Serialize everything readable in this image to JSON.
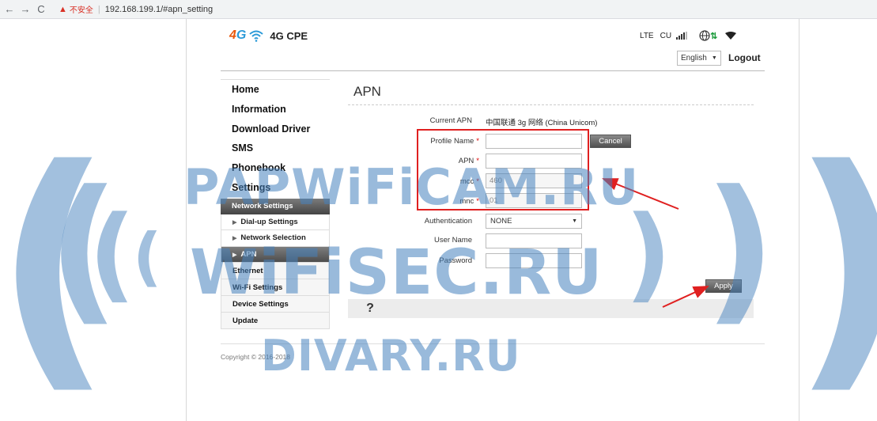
{
  "browser": {
    "back_icon": "←",
    "forward_icon": "→",
    "reload_icon": "C",
    "security_label": "不安全",
    "url": "192.168.199.1/#apn_setting"
  },
  "header": {
    "logo_text_4": "4",
    "logo_text_g": "G",
    "product_name": "4G CPE",
    "network_type": "LTE",
    "carrier": "CU",
    "language_selected": "English",
    "logout_label": "Logout"
  },
  "sidebar": {
    "items_top": [
      {
        "label": "Home"
      },
      {
        "label": "Information"
      },
      {
        "label": "Download Driver"
      },
      {
        "label": "SMS"
      },
      {
        "label": "Phonebook"
      },
      {
        "label": "Settings"
      }
    ],
    "section_label": "Network Settings",
    "sub_items": [
      {
        "label": "Dial-up Settings"
      },
      {
        "label": "Network Selection"
      },
      {
        "label": "APN"
      }
    ],
    "items_bottom": [
      {
        "label": "Ethernet"
      },
      {
        "label": "Wi-Fi Settings"
      },
      {
        "label": "Device Settings"
      },
      {
        "label": "Update"
      }
    ]
  },
  "main": {
    "title": "APN",
    "current_apn_label": "Current APN",
    "current_apn_value": "中国联通 3g 网络 (China Unicom)",
    "profile_name_label": "Profile Name",
    "profile_name_value": "",
    "apn_label": "APN",
    "apn_value": "",
    "mcc_label": "mcc",
    "mcc_value": "460",
    "mnc_label": "mnc",
    "mnc_value": "01",
    "authentication_label": "Authentication",
    "authentication_value": "NONE",
    "username_label": "User Name",
    "username_value": "",
    "password_label": "Password",
    "password_value": "",
    "required_mark": "*",
    "cancel_label": "Cancel",
    "apply_label": "Apply",
    "help_icon": "?"
  },
  "footer": {
    "copyright": "Copyright © 2016-2018"
  },
  "watermarks": {
    "line1": "PAPWiFiCAM.RU",
    "line2": "WiFiSEC.RU",
    "line3": "DIVARY.RU"
  },
  "colors": {
    "accent_orange": "#e9590c",
    "accent_blue": "#2b9ad8",
    "annotation_red": "#e02020",
    "watermark": "#4682be"
  }
}
